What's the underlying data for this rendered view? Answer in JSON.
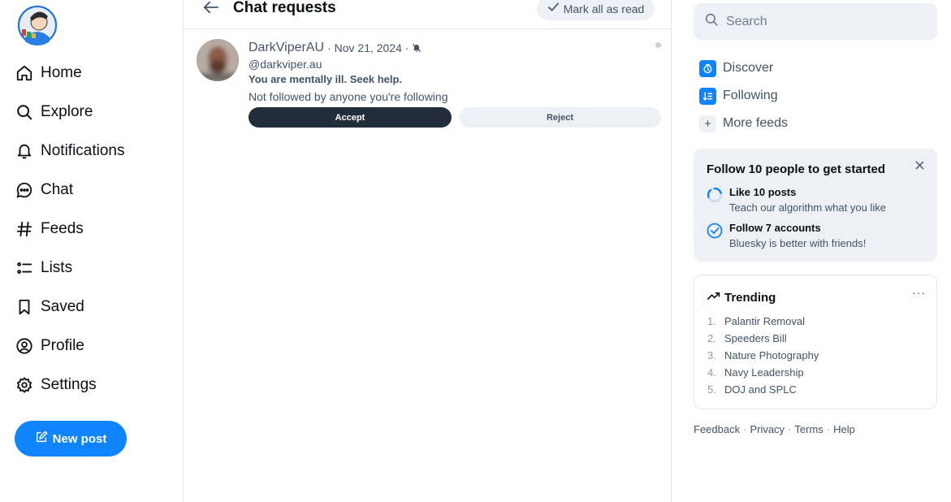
{
  "colors": {
    "accent": "#1083fe",
    "text": "#0b0f14",
    "muted": "#425466",
    "surface": "#edf1f5",
    "border": "#e3e8ee",
    "dark_button": "#222d3b"
  },
  "nav": {
    "items": [
      {
        "label": "Home",
        "icon": "home-icon"
      },
      {
        "label": "Explore",
        "icon": "search-icon"
      },
      {
        "label": "Notifications",
        "icon": "bell-icon"
      },
      {
        "label": "Chat",
        "icon": "chat-bubble-icon"
      },
      {
        "label": "Feeds",
        "icon": "hashtag-icon"
      },
      {
        "label": "Lists",
        "icon": "list-icon"
      },
      {
        "label": "Saved",
        "icon": "bookmark-icon"
      },
      {
        "label": "Profile",
        "icon": "user-circle-icon"
      },
      {
        "label": "Settings",
        "icon": "gear-icon"
      }
    ],
    "new_post": "New post"
  },
  "header": {
    "title": "Chat requests",
    "mark_all": "Mark all as read"
  },
  "request": {
    "name": "DarkViperAU",
    "meta": "· Nov 21, 2024 ·",
    "handle": "@darkviper.au",
    "message": "You are mentally ill. Seek help.",
    "note": "Not followed by anyone you're following",
    "accept": "Accept",
    "reject": "Reject"
  },
  "search": {
    "placeholder": "Search"
  },
  "feeds": {
    "discover": "Discover",
    "following": "Following",
    "more": "More feeds"
  },
  "onboarding": {
    "title": "Follow 10 people to get started",
    "tasks": [
      {
        "title": "Like 10 posts",
        "subtitle": "Teach our algorithm what you like"
      },
      {
        "title": "Follow 7 accounts",
        "subtitle": "Bluesky is better with friends!"
      }
    ]
  },
  "trending": {
    "title": "Trending",
    "more": "···",
    "items": [
      {
        "num": "1.",
        "label": "Palantir Removal"
      },
      {
        "num": "2.",
        "label": "Speeders Bill"
      },
      {
        "num": "3.",
        "label": "Nature Photography"
      },
      {
        "num": "4.",
        "label": "Navy Leadership"
      },
      {
        "num": "5.",
        "label": "DOJ and SPLC"
      }
    ]
  },
  "footer": {
    "feedback": "Feedback",
    "privacy": "Privacy",
    "terms": "Terms",
    "help": "Help",
    "sep": "·"
  }
}
